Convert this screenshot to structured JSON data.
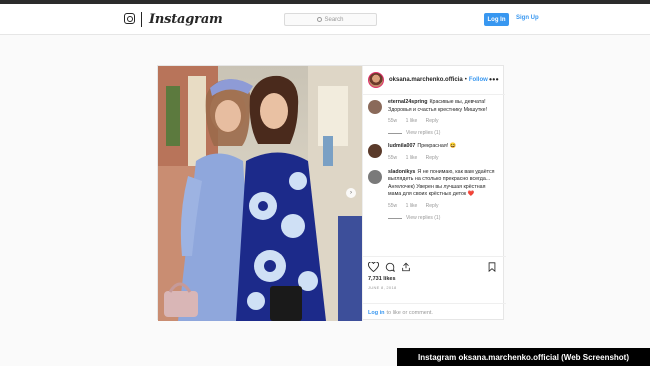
{
  "nav": {
    "brand": "Instagram",
    "brand_icon": "instagram-camera-icon",
    "search_placeholder": "Search",
    "login_label": "Log In",
    "signup_label": "Sign Up"
  },
  "post": {
    "username": "oksana.marchenko.officia",
    "dot": "•",
    "follow_label": "Follow",
    "more_icon": "more-dots-icon",
    "more_glyph": "•••",
    "comments": [
      {
        "user": "eternal24spring",
        "text": "Красивые вы, девчата! Здоровья и счастья крестнику Мишутке!",
        "time": "55w",
        "likes": "1 like",
        "reply": "Reply",
        "view_replies": "View replies (1)",
        "avatar_color": "#8a6a5a"
      },
      {
        "user": "ludmila007",
        "text": "Прекрасная! 😆",
        "time": "55w",
        "likes": "1 like",
        "reply": "Reply",
        "view_replies": "",
        "avatar_color": "#5a3a2a"
      },
      {
        "user": "sladonikys",
        "text": "Я не понимаю, как вам удаётся выглядеть на столько прекрасно всегда... Ангелочек) Уверен вы лучшая крёстная мама для своих крёстных деток ❤️",
        "time": "55w",
        "likes": "1 like",
        "reply": "Reply",
        "view_replies": "View replies (1)",
        "avatar_color": "#7a7a7a"
      }
    ],
    "likes": "7,731 likes",
    "date": "JUNE 8, 2018",
    "login_link": "Log in",
    "login_suffix": "to like or comment.",
    "next_icon": "chevron-right-icon",
    "next_glyph": "›"
  },
  "caption": "Instagram oksana.marchenko.official (Web Screenshot)",
  "colors": {
    "accent": "#3897f0",
    "text": "#262626",
    "muted": "#999999"
  }
}
